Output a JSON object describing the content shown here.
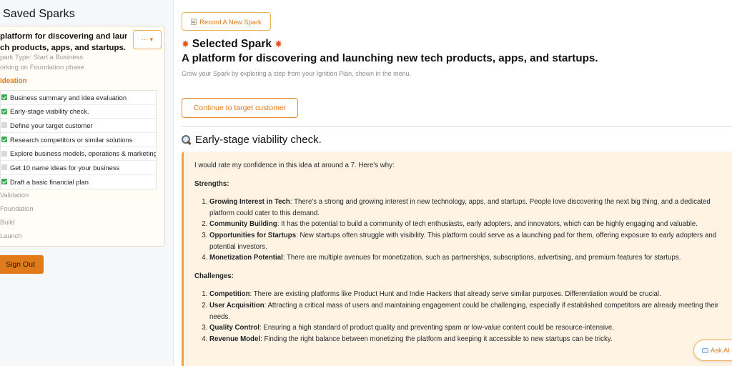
{
  "sidebar": {
    "title": "Saved Sparks",
    "spark": {
      "title_line1": "platform for discovering and launching new tech",
      "title_line2": "ch products, apps, and startups.",
      "menu_label": "··· ▾",
      "type_text": "park Type: Start a Business",
      "status_text": "orking on Foundation phase",
      "active_phase": "Ideation",
      "steps": [
        {
          "label": "Business summary and idea evaluation",
          "done": true
        },
        {
          "label": "Early-stage viability check.",
          "done": true
        },
        {
          "label": "Define your target customer",
          "done": false
        },
        {
          "label": "Research competitors or similar solutions",
          "done": true
        },
        {
          "label": "Explore business models, operations & marketing",
          "done": false
        },
        {
          "label": "Get 10 name ideas for your business",
          "done": false
        },
        {
          "label": "Draft a basic financial plan",
          "done": true
        }
      ],
      "phases": [
        "Validation",
        "Foundation",
        "Build",
        "Launch"
      ]
    },
    "sign_out_label": "Sign Out"
  },
  "main": {
    "record_button_label": "Record A New Spark",
    "selected_label": "Selected Spark",
    "spark_title": "A platform for discovering and launching new tech products, apps, and startups.",
    "subtitle": "Grow your Spark by exploring a step from your Ignition Plan, shown in the menu.",
    "continue_button_label": "Continue to target customer",
    "step_heading": "Early-stage viability check.",
    "response": {
      "intro": "I would rate my confidence in this idea at around a 7. Here's why:",
      "strengths_label": "Strengths:",
      "strengths": [
        {
          "title": "Growing Interest in Tech",
          "text": ": There's a strong and growing interest in new technology, apps, and startups. People love discovering the next big thing, and a dedicated platform could cater to this demand."
        },
        {
          "title": "Community Building",
          "text": ": It has the potential to build a community of tech enthusiasts, early adopters, and innovators, which can be highly engaging and valuable."
        },
        {
          "title": "Opportunities for Startups",
          "text": ": New startups often struggle with visibility. This platform could serve as a launching pad for them, offering exposure to early adopters and potential investors."
        },
        {
          "title": "Monetization Potential",
          "text": ": There are multiple avenues for monetization, such as partnerships, subscriptions, advertising, and premium features for startups."
        }
      ],
      "challenges_label": "Challenges:",
      "challenges": [
        {
          "title": "Competition",
          "text": ": There are existing platforms like Product Hunt and Indie Hackers that already serve similar purposes. Differentiation would be crucial."
        },
        {
          "title": "User Acquisition",
          "text": ": Attracting a critical mass of users and maintaining engagement could be challenging, especially if established competitors are already meeting their needs."
        },
        {
          "title": "Quality Control",
          "text": ": Ensuring a high standard of product quality and preventing spam or low-value content could be resource-intensive."
        },
        {
          "title": "Revenue Model",
          "text": ": Finding the right balance between monetizing the platform and keeping it accessible to new startups can be tricky."
        }
      ]
    },
    "ask_ai_label": "Ask AI"
  },
  "colors": {
    "accent": "#e07b1a",
    "accent_border": "#f0b25c",
    "panel_bg": "#fff4e4",
    "check_green": "#3fae4e"
  }
}
